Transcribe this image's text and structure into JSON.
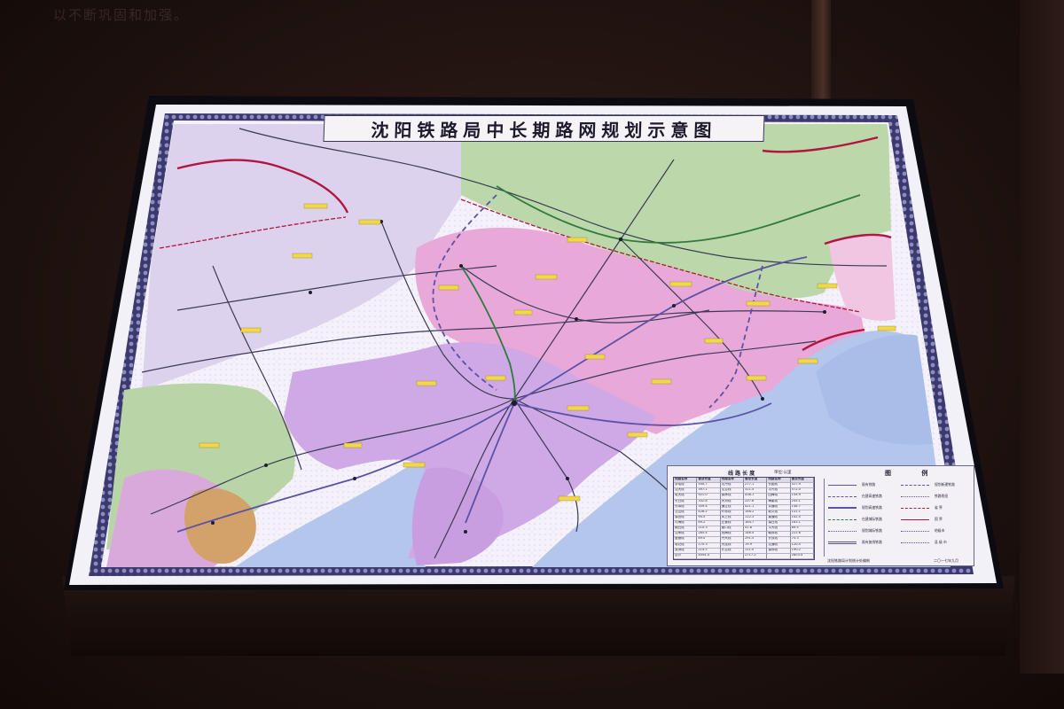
{
  "wall": {
    "caption": "以不断巩固和加强。"
  },
  "map": {
    "title": "沈阳铁路局中长期路网规划示意图",
    "colors": {
      "border_pattern": "#3b3a6e",
      "paper": "#f2eff6",
      "province_pink": "#e6a6d6",
      "province_lilac": "#cda6e4",
      "province_lavender": "#d9cdec",
      "province_green": "#b9d4a7",
      "province_tan": "#d2a26a",
      "sea_blue": "#b4c6ec",
      "boundary_red": "#b0163e",
      "existing_rail": "#3a3a55",
      "planned_rail": "#5b52a6",
      "highspeed_rail": "#2f7a3f",
      "label_yellow": "#f0d84a"
    },
    "table": {
      "title": "线 路 长 度",
      "unit": "单位:公里",
      "headers": [
        "线路名称",
        "营业长度",
        "线路名称",
        "营业长度",
        "线路名称",
        "营业长度"
      ],
      "rows": [
        [
          "京哈线",
          "544.7",
          "沈丹线",
          "277.1",
          "长图线",
          "527.9"
        ],
        [
          "沈大线",
          "397.1",
          "沈吉线",
          "311.5",
          "平齐线",
          "572.0"
        ],
        [
          "哈大线",
          "921.0",
          "锦承线",
          "436.1",
          "四梅线",
          "154.9"
        ],
        [
          "长白线",
          "332.8",
          "大郑线",
          "237.6",
          "梅集线",
          "245.1"
        ],
        [
          "长珲线",
          "359.4",
          "通让线",
          "421.1",
          "京通线",
          "148.7"
        ],
        [
          "沈山线",
          "426.2",
          "叶赤线",
          "146.2",
          "新义线",
          "131.1"
        ],
        [
          "溪田线",
          "94.5",
          "凤上线",
          "112.3",
          "集通线",
          "142.5"
        ],
        [
          "沟海线",
          "89.2",
          "庄营线",
          "164.7",
          "锦白线",
          "183.1"
        ],
        [
          "烟白线",
          "210.3",
          "营口线",
          "41.8",
          "平大线",
          "89.5"
        ],
        [
          "沈承线",
          "285.4",
          "抚梅线",
          "146.4",
          "朝赤线",
          "222.6"
        ],
        [
          "盘营线",
          "89.0",
          "丹大线",
          "291.5",
          "长双线",
          "75.3"
        ],
        [
          "哈牡线",
          "170.3",
          "大连线",
          "19.9",
          "沈通线",
          "120.5"
        ],
        [
          "滨洲线",
          "214.5",
          "长吉线",
          "111.0",
          "锦赤线",
          "190.2"
        ],
        [
          "合计",
          "4054.4",
          "",
          "2717.2",
          "",
          "2803.4"
        ]
      ]
    },
    "legend": {
      "title": "图 例",
      "items": [
        "既有铁路",
        "在建高速铁路",
        "规划高速铁路",
        "在建城际铁路",
        "规划城际铁路",
        "既有复线铁路",
        "规划新建铁路",
        "铁路枢纽",
        "省 界",
        "国 界",
        "地级市",
        "县 级 市"
      ]
    },
    "footer": {
      "left": "沈阳铁路局计划统计处编制",
      "right": "二〇一七年九月"
    }
  }
}
